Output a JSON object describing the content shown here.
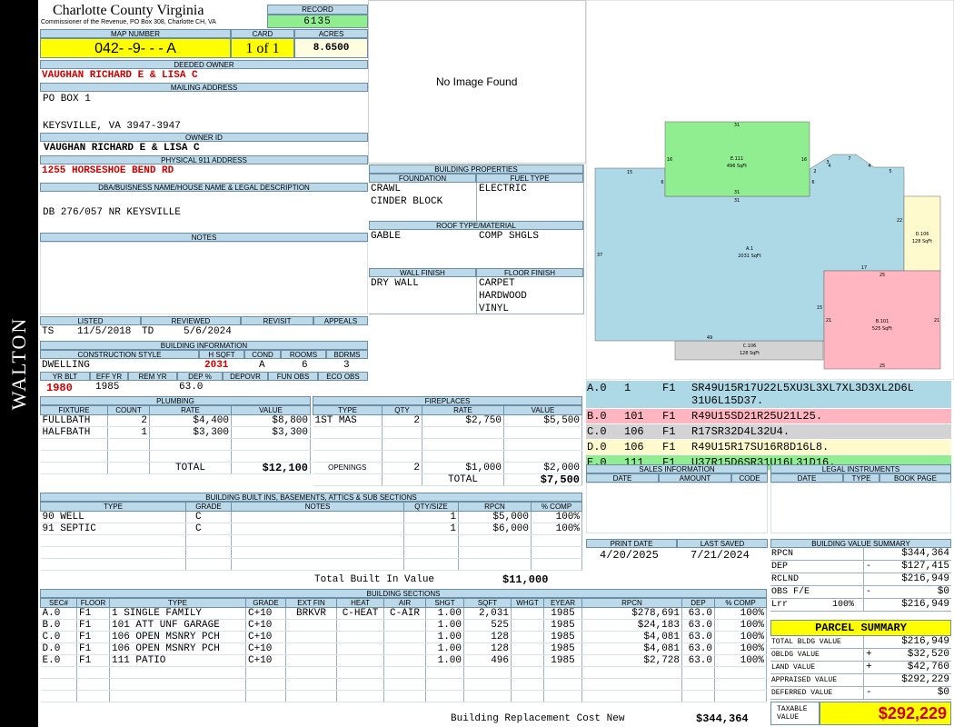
{
  "sidebar_label": "WALTON",
  "header": {
    "county": "Charlotte County Virginia",
    "office": "Commissioner of the Revenue, PO Box 308, Charlotte CH, VA",
    "record_label": "RECORD",
    "record": "6135",
    "map_label": "MAP NUMBER",
    "map_number": "042- -9- - - A",
    "card_label": "CARD",
    "card": "1 of 1",
    "acres_label": "ACRES",
    "acres": "8.6500"
  },
  "owner": {
    "deeded_label": "DEEDED OWNER",
    "deeded": "VAUGHAN RICHARD E & LISA C",
    "mailing_label": "MAILING ADDRESS",
    "mailing_line1": "PO BOX 1",
    "mailing_line2": "KEYSVILLE, VA 3947-3947",
    "owner_id_label": "OWNER ID",
    "owner_id": "VAUGHAN RICHARD E & LISA C",
    "address_label": "PHYSICAL 911 ADDRESS",
    "address": "1255 HORSESHOE BEND RD",
    "dba_label": "DBA/BUISNESS NAME/HOUSE NAME & LEGAL DESCRIPTION",
    "dba": "DB 276/057 NR KEYSVILLE",
    "notes_label": "NOTES"
  },
  "photo": {
    "text": "No Image Found"
  },
  "building_props": {
    "title": "BUILDING PROPERTIES",
    "foundation_label": "FOUNDATION",
    "foundation": [
      "CRAWL",
      "CINDER BLOCK"
    ],
    "fuel_label": "FUEL TYPE",
    "fuel": "ELECTRIC",
    "roof_label": "ROOF TYPE/MATERIAL",
    "roof_type": "GABLE",
    "roof_material": "COMP SHGLS",
    "wall_label": "WALL FINISH",
    "wall": "DRY WALL",
    "floor_label": "FLOOR FINISH",
    "floor": [
      "CARPET",
      "HARDWOOD",
      "VINYL"
    ]
  },
  "dates": {
    "listed_label": "LISTED",
    "listed_code": "TS",
    "listed": "11/5/2018",
    "reviewed_label": "REVIEWED",
    "reviewed_code": "TD",
    "reviewed": "5/6/2024",
    "revisit_label": "REVISIT",
    "appeals_label": "APPEALS"
  },
  "building_info": {
    "title": "BUILDING INFORMATION",
    "style_label": "CONSTRUCTION STYLE",
    "style": "DWELLING",
    "hsqft_label": "H SQFT",
    "hsqft": "2031",
    "cond_label": "COND",
    "cond": "A",
    "rooms_label": "ROOMS",
    "rooms": "6",
    "bdrms_label": "BDRMS",
    "bdrms": "3",
    "yrblt_label": "YR BLT",
    "yrblt": "1980",
    "effyr_label": "EFF YR",
    "effyr": "1985",
    "remyr_label": "REM YR",
    "dep_label": "DEP %",
    "dep": "63.0",
    "depovr_label": "DEPOVR",
    "funobs_label": "FUN OBS",
    "ecoobs_label": "ECO OBS"
  },
  "plumbing": {
    "title": "PLUMBING",
    "headers": [
      "FIXTURE",
      "COUNT",
      "RATE",
      "VALUE"
    ],
    "rows": [
      {
        "fixture": "FULLBATH",
        "count": "2",
        "rate": "$4,400",
        "value": "$8,800"
      },
      {
        "fixture": "HALFBATH",
        "count": "1",
        "rate": "$3,300",
        "value": "$3,300"
      }
    ],
    "total_label": "TOTAL",
    "total": "$12,100"
  },
  "fireplaces": {
    "title": "FIREPLACES",
    "headers": [
      "TYPE",
      "QTY",
      "RATE",
      "VALUE"
    ],
    "rows": [
      {
        "type": "1ST MAS",
        "qty": "2",
        "rate": "$2,750",
        "value": "$5,500"
      }
    ],
    "openings_label": "OPENINGS",
    "openings_qty": "2",
    "openings_rate": "$1,000",
    "openings_value": "$2,000",
    "total_label": "TOTAL",
    "total": "$7,500"
  },
  "builtins": {
    "title": "BUILDING BUILT INS, BASEMENTS, ATTICS & SUB SECTIONS",
    "headers": [
      "TYPE",
      "GRADE",
      "NOTES",
      "QTY/SIZE",
      "RPCN",
      "% COMP"
    ],
    "rows": [
      {
        "type": "90 WELL",
        "grade": "C",
        "notes": "",
        "qty": "1",
        "rpcn": "$5,000",
        "comp": "100%"
      },
      {
        "type": "91 SEPTIC",
        "grade": "C",
        "notes": "",
        "qty": "1",
        "rpcn": "$6,000",
        "comp": "100%"
      }
    ],
    "total_label": "Total Built In Value",
    "total": "$11,000"
  },
  "sections": {
    "title": "BUILDING SECTIONS",
    "headers": [
      "SEC#",
      "FLOOR",
      "TYPE",
      "GRADE",
      "EXT FIN",
      "HEAT",
      "AIR",
      "SHGT",
      "SQFT",
      "WHGT",
      "EYEAR",
      "RPCN",
      "DEP",
      "% COMP"
    ],
    "rows": [
      {
        "sec": "A.0",
        "floor": "F1",
        "type": "1 SINGLE FAMILY",
        "grade": "C+10",
        "ext": "BRKVR",
        "heat": "C-HEAT",
        "air": "C-AIR",
        "shgt": "1.00",
        "sqft": "2,031",
        "whgt": "",
        "eyear": "1985",
        "rpcn": "$278,691",
        "dep": "63.0",
        "comp": "100%"
      },
      {
        "sec": "B.0",
        "floor": "F1",
        "type": "101 ATT UNF GARAGE",
        "grade": "C+10",
        "ext": "",
        "heat": "",
        "air": "",
        "shgt": "1.00",
        "sqft": "525",
        "whgt": "",
        "eyear": "1985",
        "rpcn": "$24,183",
        "dep": "63.0",
        "comp": "100%"
      },
      {
        "sec": "C.0",
        "floor": "F1",
        "type": "106 OPEN MSNRY PCH",
        "grade": "C+10",
        "ext": "",
        "heat": "",
        "air": "",
        "shgt": "1.00",
        "sqft": "128",
        "whgt": "",
        "eyear": "1985",
        "rpcn": "$4,081",
        "dep": "63.0",
        "comp": "100%"
      },
      {
        "sec": "D.0",
        "floor": "F1",
        "type": "106 OPEN MSNRY PCH",
        "grade": "C+10",
        "ext": "",
        "heat": "",
        "air": "",
        "shgt": "1.00",
        "sqft": "128",
        "whgt": "",
        "eyear": "1985",
        "rpcn": "$4,081",
        "dep": "63.0",
        "comp": "100%"
      },
      {
        "sec": "E.0",
        "floor": "F1",
        "type": "111 PATIO",
        "grade": "C+10",
        "ext": "",
        "heat": "",
        "air": "",
        "shgt": "1.00",
        "sqft": "496",
        "whgt": "",
        "eyear": "1985",
        "rpcn": "$2,728",
        "dep": "63.0",
        "comp": "100%"
      }
    ],
    "total_label": "Building Replacement Cost New",
    "total": "$344,364"
  },
  "sketch": {
    "areas": [
      {
        "id": "a",
        "label": "A.1",
        "sqft": "2031 SqFt",
        "color": "#add8e6"
      },
      {
        "id": "b",
        "label": "B.101",
        "sqft": "525 SqFt",
        "color": "#ffb6c1"
      },
      {
        "id": "c",
        "label": "C.106",
        "sqft": "128 SqFt",
        "color": "#d3d3d3"
      },
      {
        "id": "d",
        "label": "D.106",
        "sqft": "128 SqFt",
        "color": "#fffacd"
      },
      {
        "id": "e",
        "label": "E.111",
        "sqft": "496 SqFt",
        "color": "#90ee90"
      }
    ],
    "dims": [
      "31",
      "16",
      "16",
      "6",
      "31",
      "31",
      "15",
      "2",
      "3",
      "7",
      "4",
      "4",
      "5",
      "6",
      "22",
      "37",
      "17",
      "25",
      "15",
      "21",
      "21",
      "49",
      "25"
    ]
  },
  "legend": [
    {
      "sec": "A.0",
      "num": "1",
      "floor": "F1",
      "path": "SR49U15R17U22L5XU3L3XL7XL3D3XL2D6L",
      "path2": "31U6L15D37.",
      "color": "#add8e6"
    },
    {
      "sec": "B.0",
      "num": "101",
      "floor": "F1",
      "path": "R49U15SD21R25U21L25.",
      "color": "#ffb6c1"
    },
    {
      "sec": "C.0",
      "num": "106",
      "floor": "F1",
      "path": "R17SR32D4L32U4.",
      "color": "#d3d3d3"
    },
    {
      "sec": "D.0",
      "num": "106",
      "floor": "F1",
      "path": "R49U15R17SU16R8D16L8.",
      "color": "#fffacd"
    },
    {
      "sec": "E.0",
      "num": "111",
      "floor": "F1",
      "path": "U37R15D6SR31U16L31D16.",
      "color": "#90ee90"
    }
  ],
  "sales": {
    "title": "SALES INFORMATION",
    "headers": [
      "DATE",
      "AMOUNT",
      "CODE"
    ]
  },
  "legal": {
    "title": "LEGAL INSTRUMENTS",
    "headers": [
      "DATE",
      "TYPE",
      "BOOK PAGE"
    ]
  },
  "print": {
    "print_label": "PRINT DATE",
    "print_date": "4/20/2025",
    "saved_label": "LAST SAVED",
    "saved_date": "7/21/2024"
  },
  "value_summary": {
    "title": "BUILDING VALUE SUMMARY",
    "rows": [
      {
        "label": "RPCN",
        "sign": "",
        "value": "$344,364"
      },
      {
        "label": "DEP",
        "sign": "-",
        "value": "$127,415"
      },
      {
        "label": "RCLND",
        "sign": "",
        "value": "$216,949"
      },
      {
        "label": "OBS F/E",
        "sign": "-",
        "value": "$0"
      },
      {
        "label": "Lrr",
        "pct": "100%",
        "sign": "",
        "value": "$216,949"
      }
    ]
  },
  "parcel": {
    "title": "PARCEL SUMMARY",
    "rows": [
      {
        "label": "TOTAL BLDG VALUE",
        "sign": "",
        "value": "$216,949"
      },
      {
        "label": "OBLDG VALUE",
        "sign": "+",
        "value": "$32,520"
      },
      {
        "label": "LAND VALUE",
        "sign": "+",
        "value": "$42,760"
      },
      {
        "label": "APPRAISED VALUE",
        "sign": "",
        "value": "$292,229"
      },
      {
        "label": "DEFERRED VALUE",
        "sign": "-",
        "value": "$0"
      }
    ],
    "taxable_label1": "TAXABLE",
    "taxable_label2": "VALUE",
    "taxable": "$292,229"
  }
}
